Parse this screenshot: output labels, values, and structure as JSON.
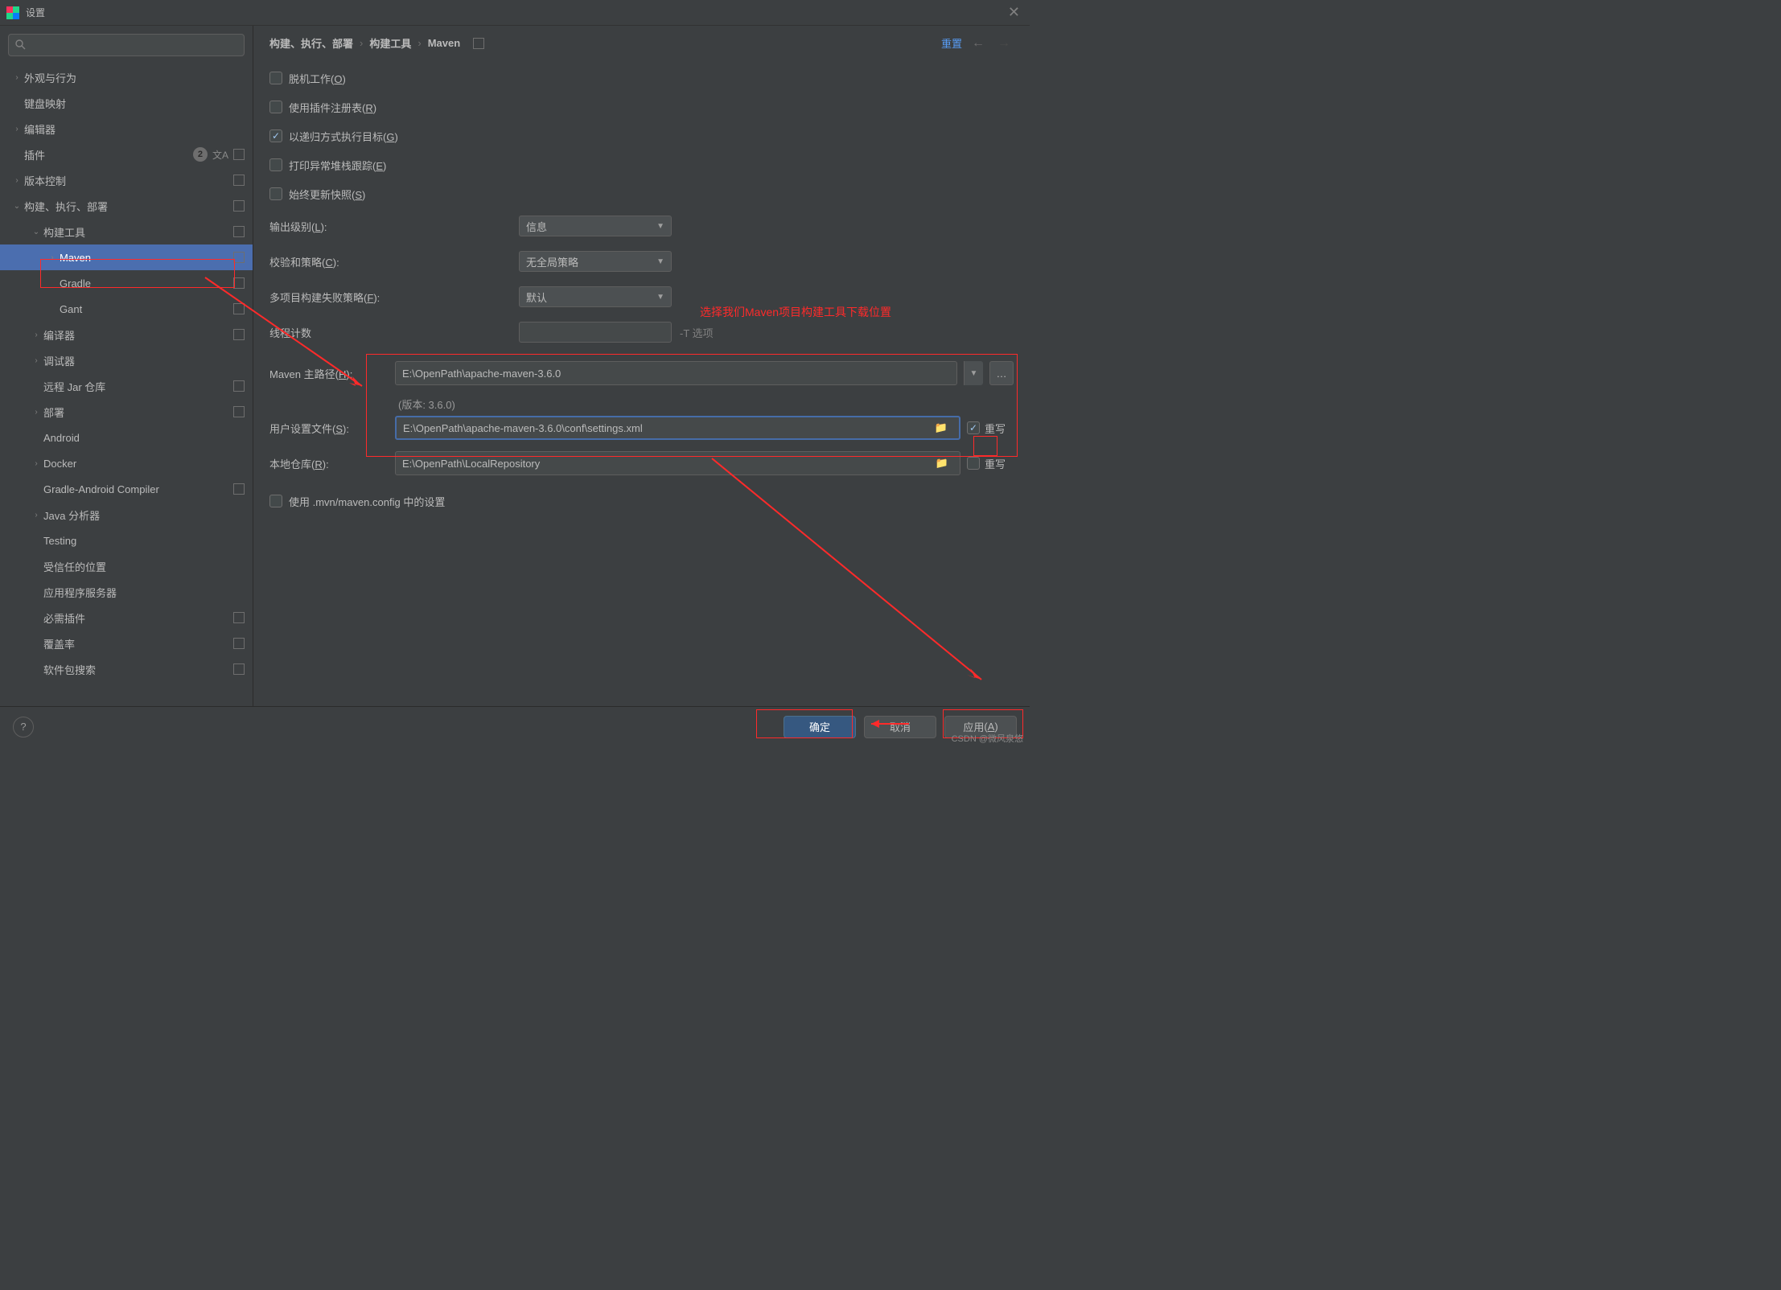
{
  "title": "设置",
  "search_placeholder": "",
  "sidebar": {
    "items": [
      {
        "label": "外观与行为",
        "arrow": "›"
      },
      {
        "label": "键盘映射",
        "arrow": ""
      },
      {
        "label": "编辑器",
        "arrow": "›"
      },
      {
        "label": "插件",
        "arrow": "",
        "badge": "2",
        "lang": true,
        "sq": true
      },
      {
        "label": "版本控制",
        "arrow": "›",
        "sq": true
      },
      {
        "label": "构建、执行、部署",
        "arrow": "⌄",
        "sq": true
      },
      {
        "label": "构建工具",
        "arrow": "⌄",
        "sq": true,
        "indent": 1
      },
      {
        "label": "Maven",
        "arrow": "›",
        "sq": true,
        "indent": 2,
        "selected": true
      },
      {
        "label": "Gradle",
        "arrow": "",
        "sq": true,
        "indent": 2
      },
      {
        "label": "Gant",
        "arrow": "",
        "sq": true,
        "indent": 2
      },
      {
        "label": "编译器",
        "arrow": "›",
        "sq": true,
        "indent": 1
      },
      {
        "label": "调试器",
        "arrow": "›",
        "indent": 1
      },
      {
        "label": "远程 Jar 仓库",
        "arrow": "",
        "sq": true,
        "indent": 1
      },
      {
        "label": "部署",
        "arrow": "›",
        "sq": true,
        "indent": 1
      },
      {
        "label": "Android",
        "arrow": "",
        "indent": 1
      },
      {
        "label": "Docker",
        "arrow": "›",
        "indent": 1
      },
      {
        "label": "Gradle-Android Compiler",
        "arrow": "",
        "sq": true,
        "indent": 1
      },
      {
        "label": "Java 分析器",
        "arrow": "›",
        "indent": 1
      },
      {
        "label": "Testing",
        "arrow": "",
        "indent": 1
      },
      {
        "label": "受信任的位置",
        "arrow": "",
        "indent": 1
      },
      {
        "label": "应用程序服务器",
        "arrow": "",
        "indent": 1
      },
      {
        "label": "必需插件",
        "arrow": "",
        "sq": true,
        "indent": 1
      },
      {
        "label": "覆盖率",
        "arrow": "",
        "sq": true,
        "indent": 1
      },
      {
        "label": "软件包搜索",
        "arrow": "",
        "sq": true,
        "indent": 1
      }
    ]
  },
  "breadcrumb": [
    "构建、执行、部署",
    "构建工具",
    "Maven"
  ],
  "reset_label": "重置",
  "checks": {
    "offline": "脱机工作",
    "offline_u": "O",
    "registry": "使用插件注册表",
    "registry_u": "R",
    "recursive": "以递归方式执行目标",
    "recursive_u": "G",
    "recursive_checked": true,
    "stacktrace": "打印异常堆栈跟踪",
    "stacktrace_u": "E",
    "snapshot": "始终更新快照",
    "snapshot_u": "S"
  },
  "fields": {
    "output_level": "输出级别",
    "output_level_u": "L",
    "output_level_val": "信息",
    "checksum": "校验和策略",
    "checksum_u": "C",
    "checksum_val": "无全局策略",
    "multi": "多项目构建失败策略",
    "multi_u": "F",
    "multi_val": "默认",
    "threads": "线程计数",
    "threads_hint": "-T 选项",
    "home": "Maven 主路径",
    "home_u": "H",
    "home_val": "E:\\OpenPath\\apache-maven-3.6.0",
    "version": "(版本: 3.6.0)",
    "user": "用户设置文件",
    "user_u": "S",
    "user_val": "E:\\OpenPath\\apache-maven-3.6.0\\conf\\settings.xml",
    "repo": "本地仓库",
    "repo_u": "R",
    "repo_val": "E:\\OpenPath\\LocalRepository",
    "overwrite": "重写",
    "useconfig": "使用 .mvn/maven.config 中的设置"
  },
  "annotation": "选择我们Maven项目构建工具下载位置",
  "buttons": {
    "ok": "确定",
    "cancel": "取消",
    "apply": "应用",
    "apply_u": "A"
  },
  "watermark": "CSDN @微风泉悠"
}
